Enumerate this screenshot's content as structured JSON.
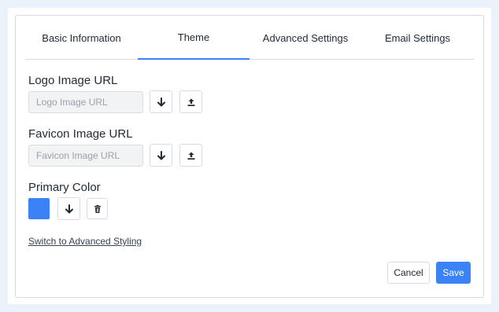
{
  "tabs": [
    {
      "label": "Basic Information",
      "active": false
    },
    {
      "label": "Theme",
      "active": true
    },
    {
      "label": "Advanced Settings",
      "active": false
    },
    {
      "label": "Email Settings",
      "active": false
    }
  ],
  "logo": {
    "label": "Logo Image URL",
    "placeholder": "Logo Image URL",
    "value": ""
  },
  "favicon": {
    "label": "Favicon Image URL",
    "placeholder": "Favicon Image URL",
    "value": ""
  },
  "primary_color": {
    "label": "Primary Color",
    "value": "#3b82f6"
  },
  "icons": {
    "download": "arrow-down-icon",
    "upload": "upload-icon",
    "delete": "trash-icon"
  },
  "switch_link": "Switch to Advanced Styling",
  "buttons": {
    "cancel": "Cancel",
    "save": "Save"
  },
  "colors": {
    "accent": "#3b82f6",
    "page_bg": "#eaf1fb",
    "border": "#d6dbe3"
  }
}
